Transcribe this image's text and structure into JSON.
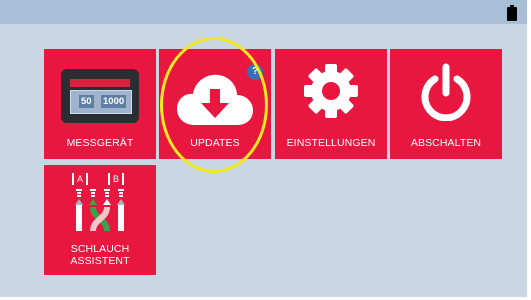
{
  "tiles": {
    "messgeraet": {
      "label": "MESSGERÄT",
      "display": {
        "value_left": "50",
        "value_right": "1000"
      }
    },
    "updates": {
      "label": "UPDATES",
      "badge": "?"
    },
    "einstellungen": {
      "label": "EINSTELLUNGEN"
    },
    "abschalten": {
      "label": "ABSCHALTEN"
    },
    "schlauch": {
      "label_line1": "SCHLAUCH",
      "label_line2": "ASSISTENT",
      "port_a": "A",
      "port_b": "B"
    }
  },
  "colors": {
    "tile": "#e8173f",
    "background": "#c9d6e4",
    "statusbar": "#a8bfd7",
    "badge": "#3a6fb4",
    "highlight": "#f2ea1e"
  },
  "icons": [
    "battery-icon",
    "meter-icon",
    "cloud-download-icon",
    "gear-icon",
    "power-icon",
    "hose-assistant-icon"
  ]
}
